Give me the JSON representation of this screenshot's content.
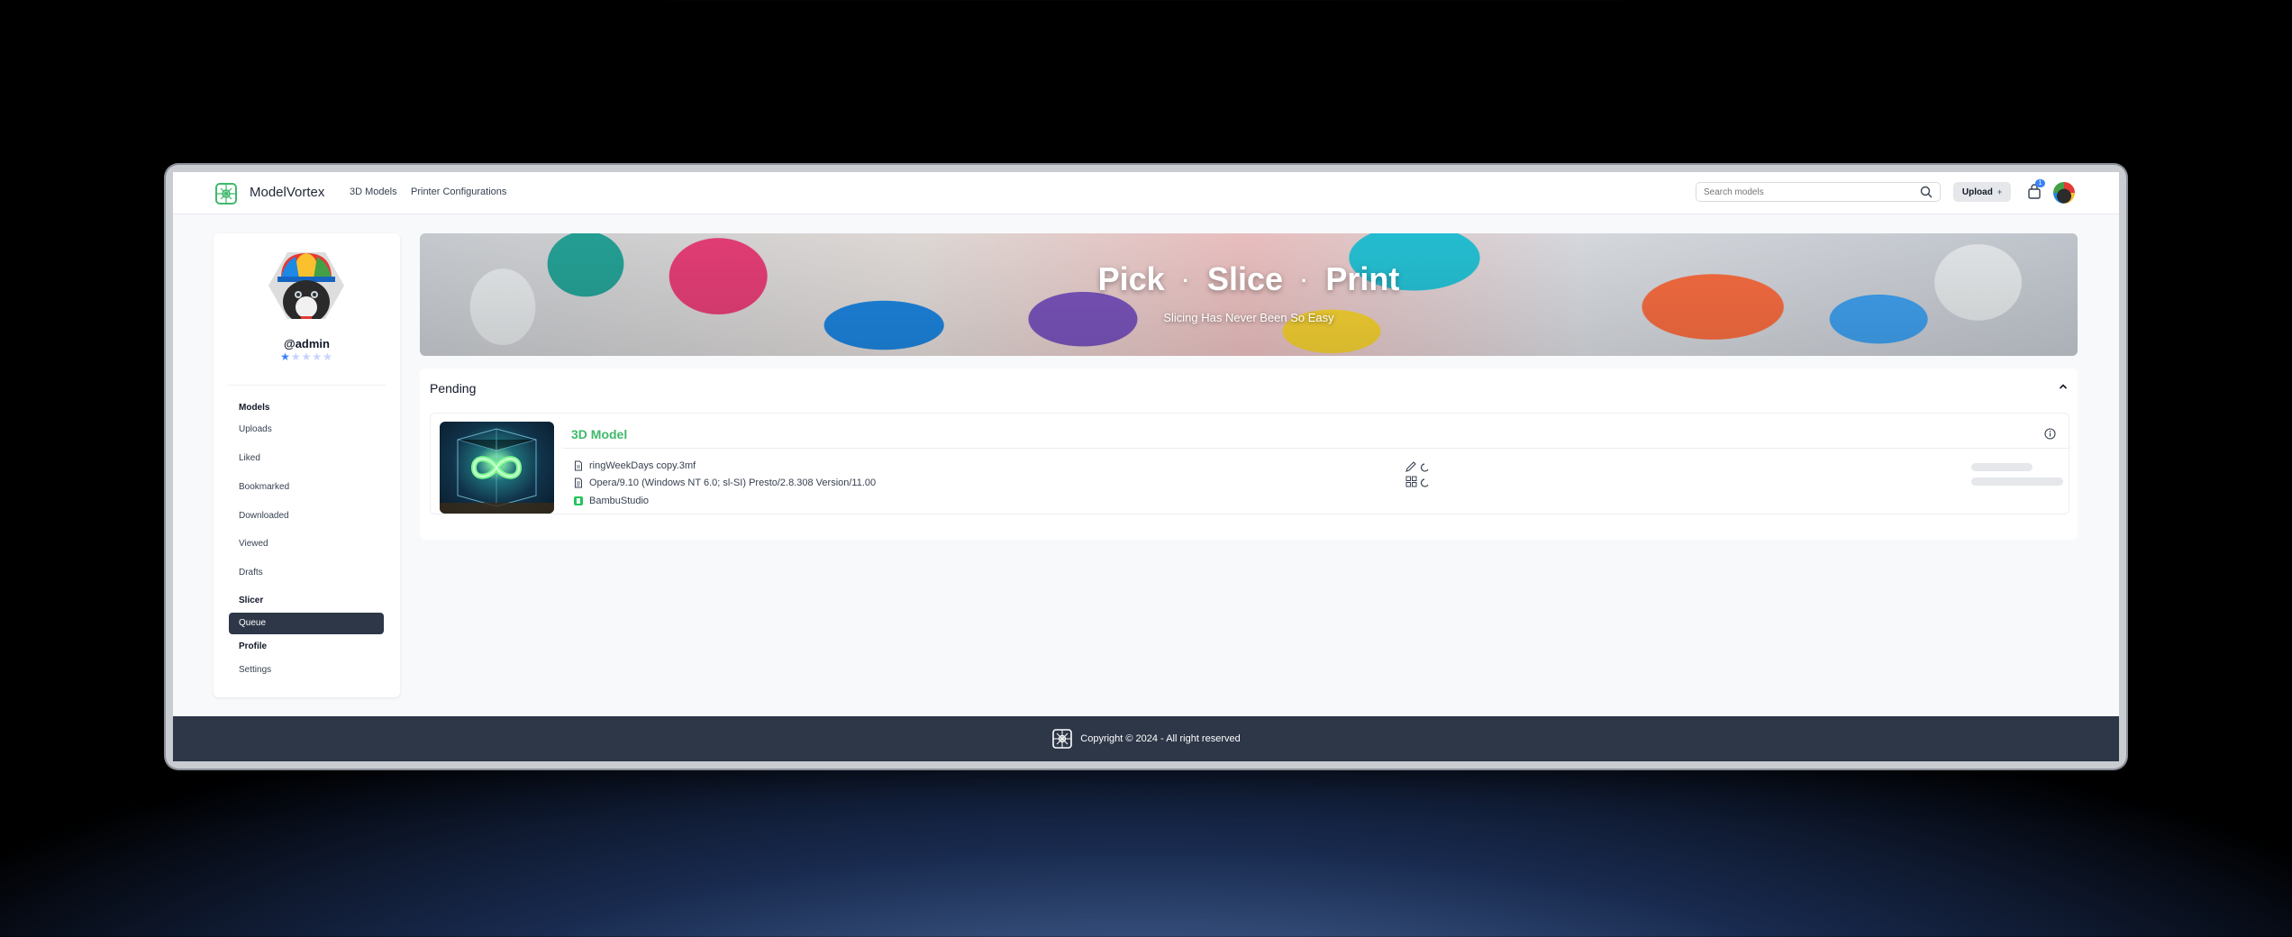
{
  "app": {
    "brand": "ModelVortex",
    "nav": [
      "3D Models",
      "Printer Configurations"
    ],
    "search_placeholder": "Search models",
    "upload_label": "Upload",
    "upload_plus": "+",
    "notification_count": "1"
  },
  "sidebar": {
    "username": "@admin",
    "rating": 1,
    "rating_max": 5,
    "sections": {
      "models": "Models",
      "slicer": "Slicer",
      "profile": "Profile"
    },
    "items": {
      "uploads": "Uploads",
      "liked": "Liked",
      "bookmarked": "Bookmarked",
      "downloaded": "Downloaded",
      "viewed": "Viewed",
      "drafts": "Drafts",
      "queue": "Queue",
      "settings": "Settings"
    }
  },
  "hero": {
    "words": [
      "Pick",
      "Slice",
      "Print"
    ],
    "separator": "·",
    "subtitle": "Slicing Has Never Been So Easy"
  },
  "pending": {
    "title": "Pending",
    "card": {
      "title": "3D Model",
      "file": "ringWeekDays copy.3mf",
      "printer": "Opera/9.10 (Windows NT 6.0; sl-SI) Presto/2.8.308 Version/11.00",
      "slicer": "BambuStudio"
    }
  },
  "footer": {
    "text": "Copyright © 2024 - All right reserved"
  },
  "colors": {
    "accent_green": "#3fb96b",
    "active_nav_bg": "#2d3748",
    "rating_blue": "#3b82f6",
    "footer_bg": "#2d3748"
  }
}
